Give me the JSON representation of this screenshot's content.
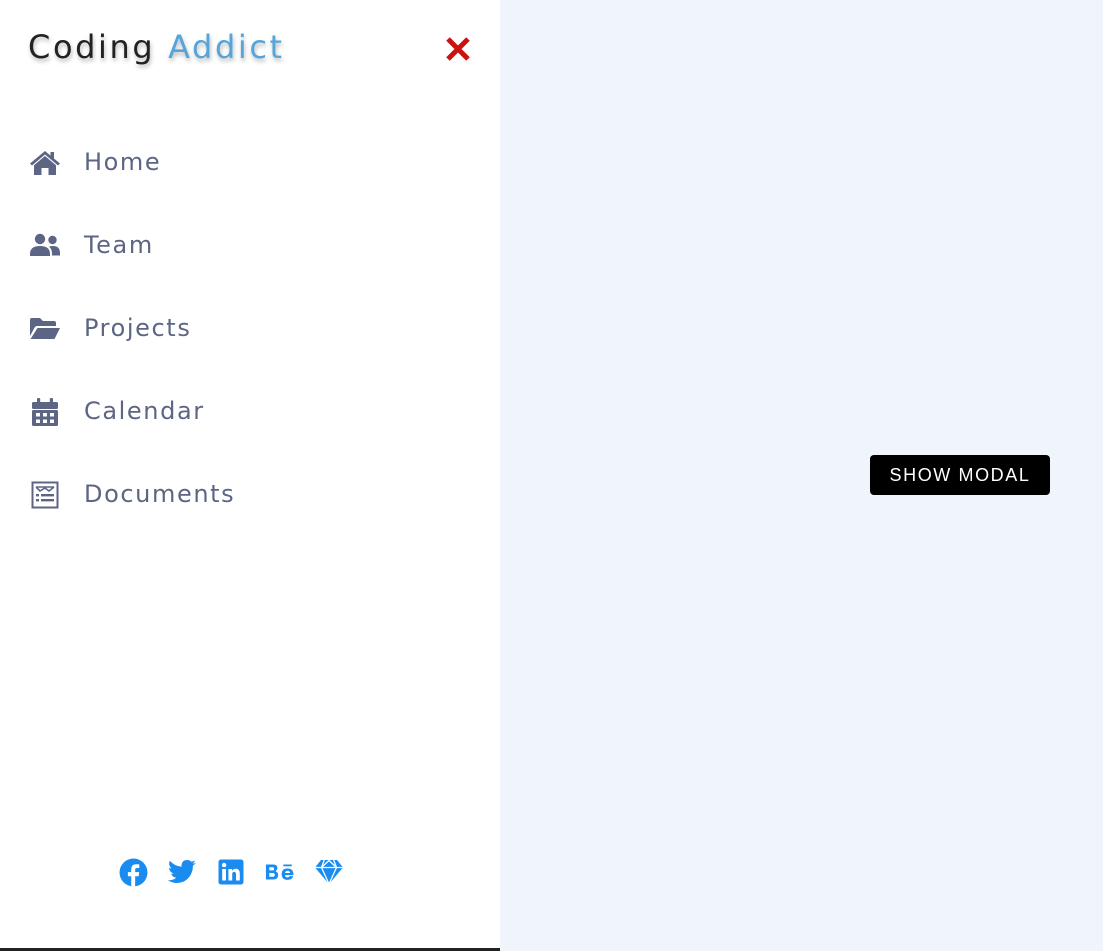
{
  "sidebar": {
    "logo": {
      "word1": "Coding",
      "word2": "Addict",
      "accent_color": "#56a5d9"
    },
    "close_icon": "close-icon",
    "close_color": "#cc1111",
    "nav_color": "#5c6584",
    "nav": [
      {
        "label": "Home",
        "icon": "home-icon"
      },
      {
        "label": "Team",
        "icon": "users-icon"
      },
      {
        "label": "Projects",
        "icon": "folder-open-icon"
      },
      {
        "label": "Calendar",
        "icon": "calendar-icon"
      },
      {
        "label": "Documents",
        "icon": "documents-icon"
      }
    ],
    "social_color": "#1a8cf0",
    "social": [
      {
        "icon": "facebook-icon"
      },
      {
        "icon": "twitter-icon"
      },
      {
        "icon": "linkedin-icon"
      },
      {
        "icon": "behance-icon"
      },
      {
        "icon": "sketch-icon"
      }
    ]
  },
  "main": {
    "background": "#f0f4fb",
    "button_label": "SHOW MODAL"
  }
}
